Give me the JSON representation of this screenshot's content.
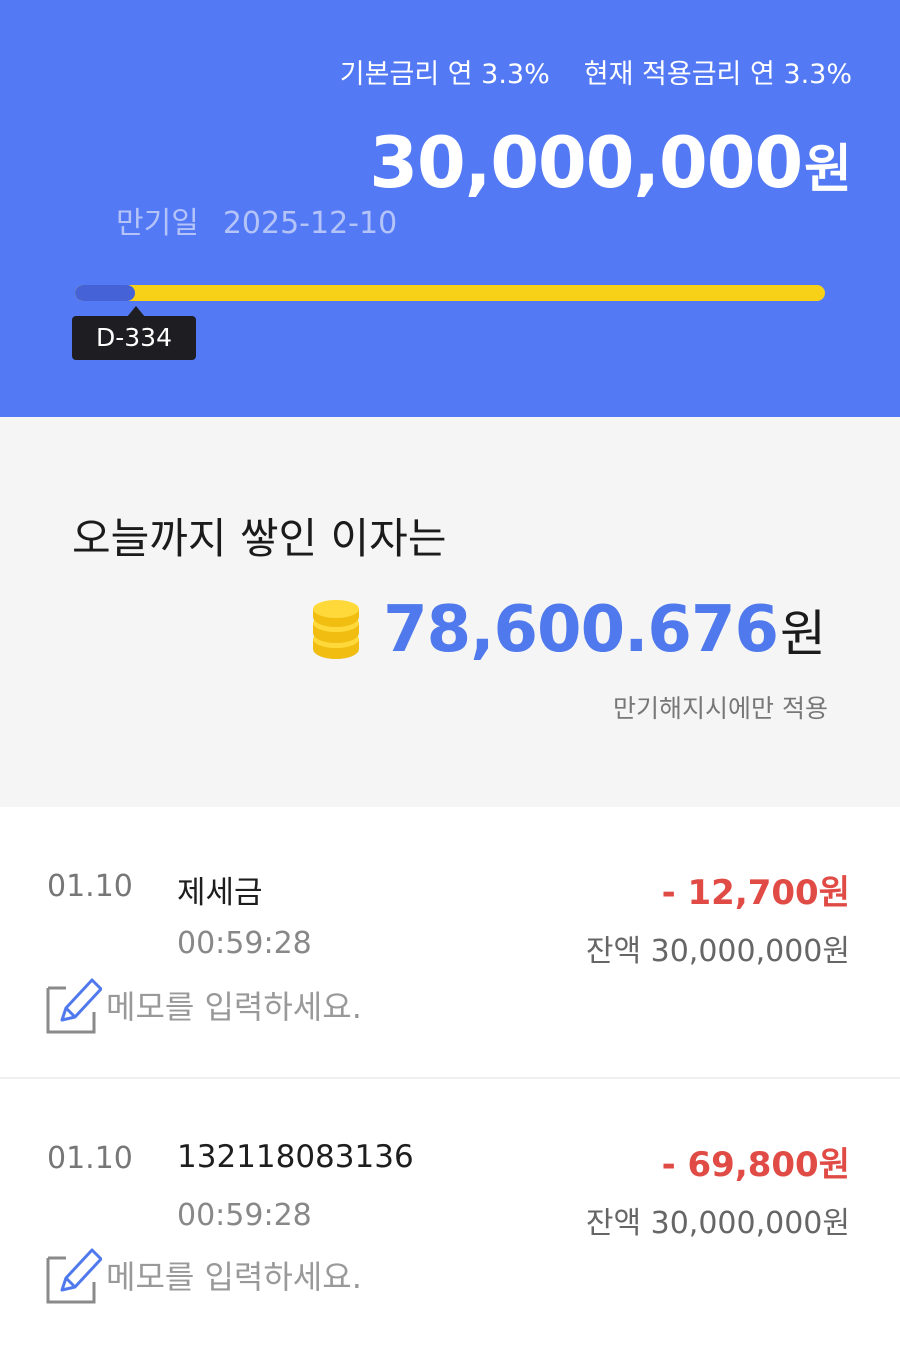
{
  "header": {
    "base_rate": "기본금리 연 3.3%",
    "applied_rate": "현재 적용금리 연 3.3%",
    "principal": "30,000,000",
    "principal_unit": "원",
    "maturity_label": "만기일",
    "maturity_date": "2025-12-10",
    "progress_fraction": 0.08,
    "dday": "D-334",
    "colors": {
      "background": "#5379f5",
      "progress_track": "#f7d118",
      "progress_fill": "#4563d6"
    }
  },
  "interest": {
    "title": "오늘까지 쌓인 이자는",
    "icon": "coin-stack-icon",
    "amount": "78,600.676",
    "unit": "원",
    "note": "만기해지시에만 적용"
  },
  "transactions": [
    {
      "date": "01.10",
      "name": "제세금",
      "time": "00:59:28",
      "amount": "- 12,700원",
      "balance": "잔액 30,000,000원",
      "memo_placeholder": "메모를 입력하세요."
    },
    {
      "date": "01.10",
      "name": "132118083136",
      "time": "00:59:28",
      "amount": "- 69,800원",
      "balance": "잔액 30,000,000원",
      "memo_placeholder": "메모를 입력하세요."
    }
  ]
}
